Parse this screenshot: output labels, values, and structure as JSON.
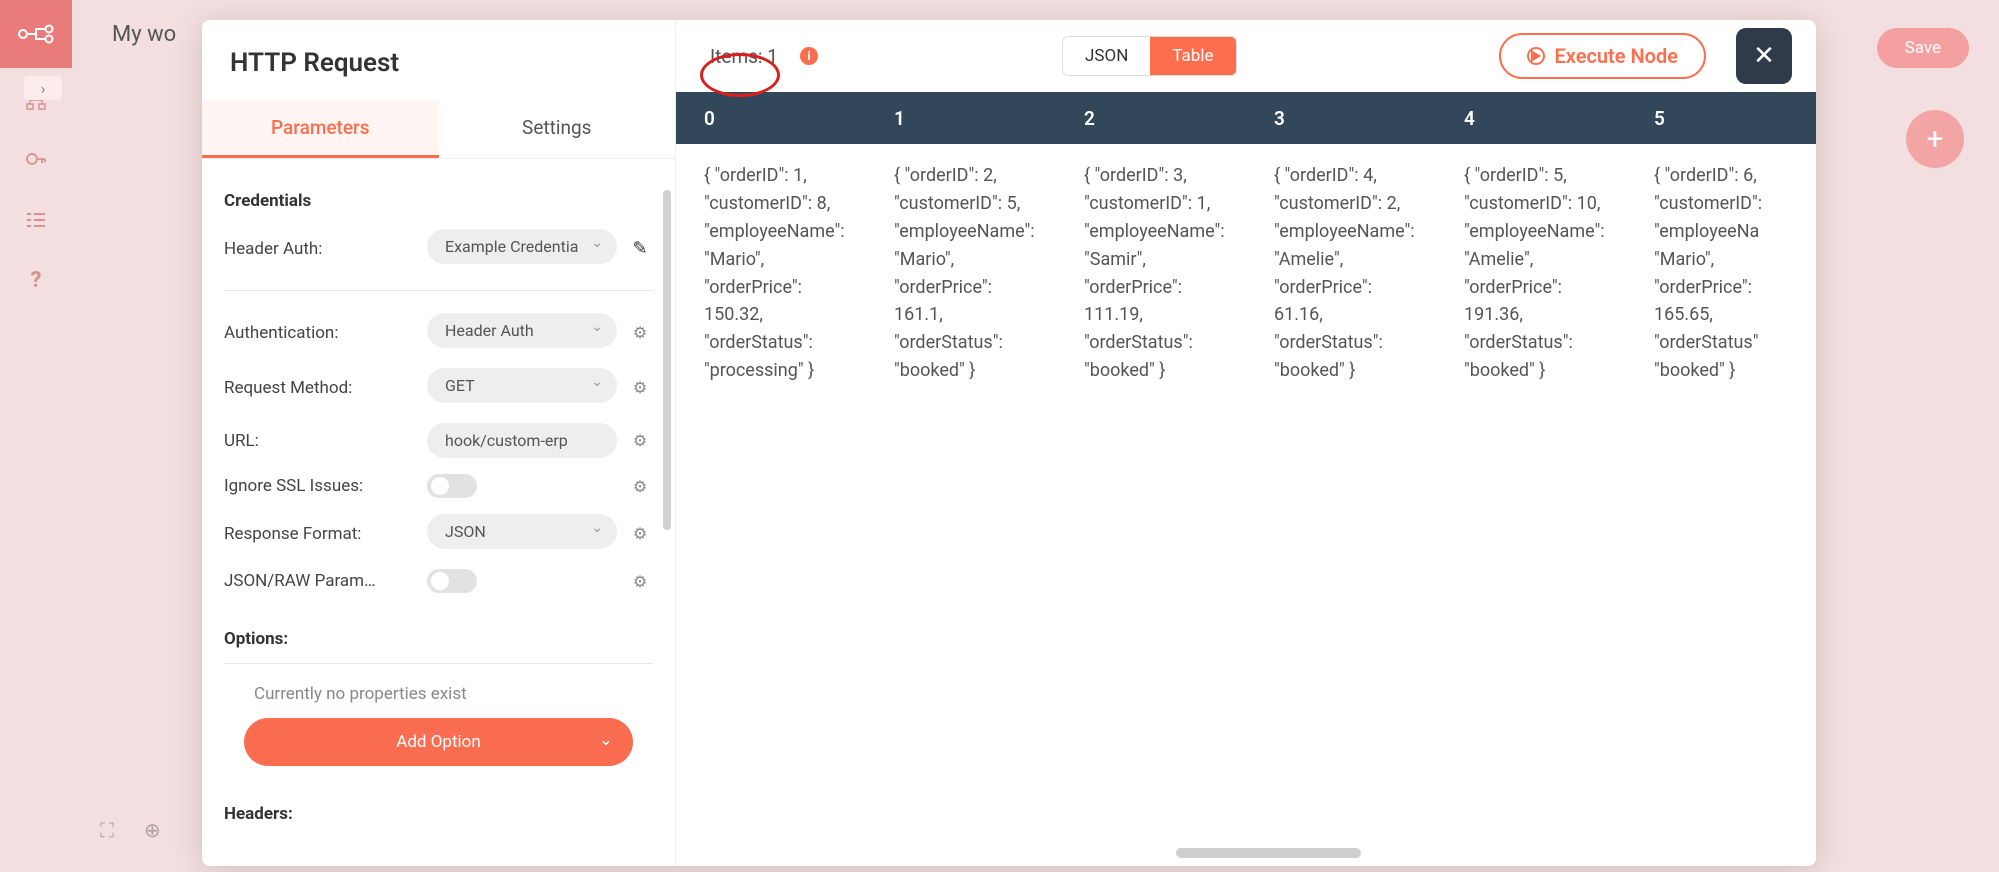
{
  "app": {
    "workflow_name": "My wo",
    "save_label": "Save"
  },
  "modal": {
    "title": "HTTP Request",
    "tabs": {
      "parameters": "Parameters",
      "settings": "Settings"
    },
    "credentials_header": "Credentials",
    "header_auth_label": "Header Auth:",
    "header_auth_value": "Example Credentia",
    "authentication_label": "Authentication:",
    "authentication_value": "Header Auth",
    "request_method_label": "Request Method:",
    "request_method_value": "GET",
    "url_label": "URL:",
    "url_value": "hook/custom-erp",
    "ignore_ssl_label": "Ignore SSL Issues:",
    "response_format_label": "Response Format:",
    "response_format_value": "JSON",
    "json_raw_label": "JSON/RAW Param…",
    "options_header": "Options:",
    "no_properties": "Currently no properties exist",
    "add_option_label": "Add Option",
    "headers_header": "Headers:"
  },
  "data": {
    "items_label": "Items: 1",
    "json_btn": "JSON",
    "table_btn": "Table",
    "execute_label": "Execute Node",
    "columns": [
      "0",
      "1",
      "2",
      "3",
      "4",
      "5"
    ],
    "rows": [
      "{ \"orderID\": 1, \"customerID\": 8, \"employeeName\": \"Mario\", \"orderPrice\": 150.32, \"orderStatus\": \"processing\" }",
      "{ \"orderID\": 2, \"customerID\": 5, \"employeeName\": \"Mario\", \"orderPrice\": 161.1, \"orderStatus\": \"booked\" }",
      "{ \"orderID\": 3, \"customerID\": 1, \"employeeName\": \"Samir\", \"orderPrice\": 111.19, \"orderStatus\": \"booked\" }",
      "{ \"orderID\": 4, \"customerID\": 2, \"employeeName\": \"Amelie\", \"orderPrice\": 61.16, \"orderStatus\": \"booked\" }",
      "{ \"orderID\": 5, \"customerID\": 10, \"employeeName\": \"Amelie\", \"orderPrice\": 191.36, \"orderStatus\": \"booked\" }",
      "{ \"orderID\": 6, \"customerID\": \"employeeNa \"Mario\", \"orderPrice\": 165.65, \"orderStatus\" \"booked\" }"
    ]
  }
}
